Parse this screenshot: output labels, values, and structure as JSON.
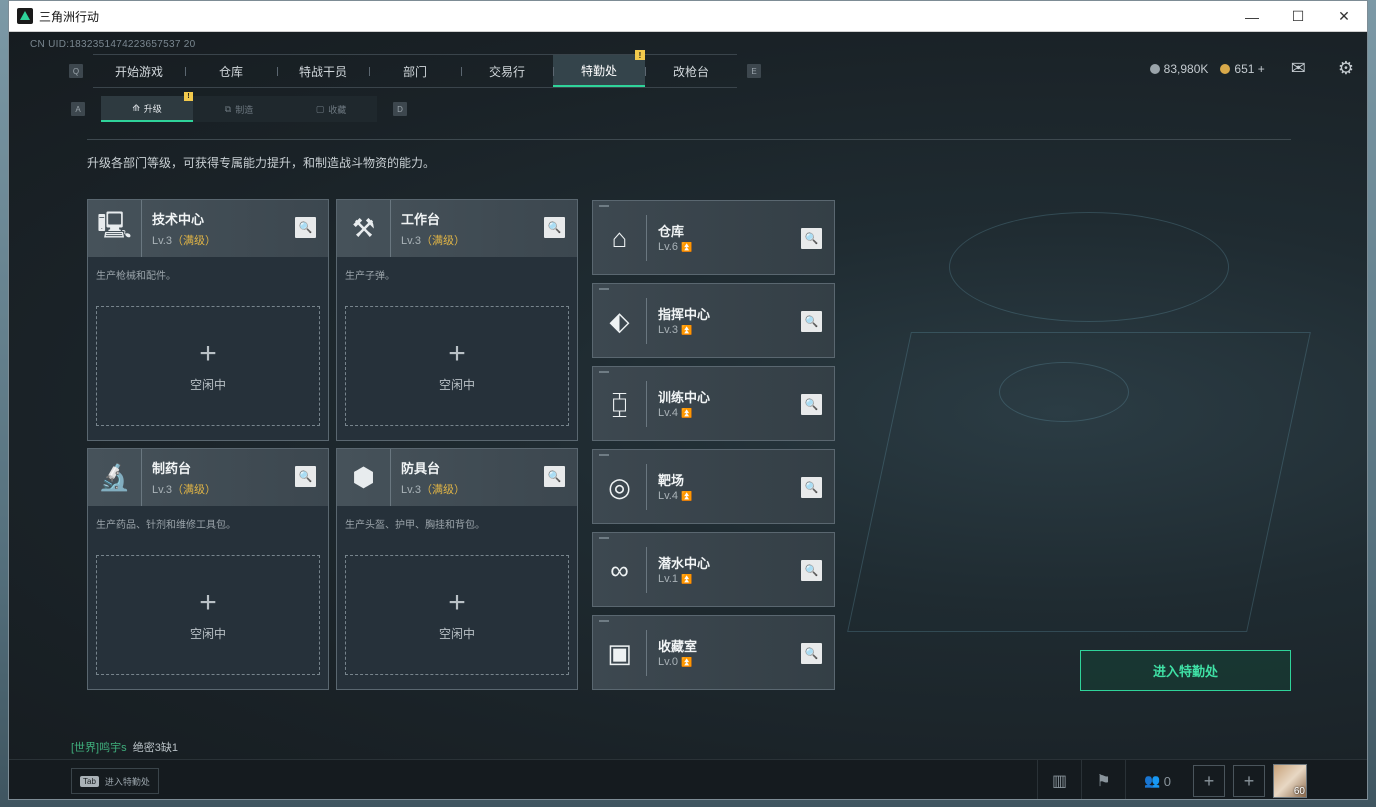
{
  "window": {
    "title": "三角洲行动"
  },
  "uid": "CN UID:1832351474223657537 20",
  "nav": {
    "key_left": "Q",
    "key_right": "E",
    "tabs": [
      {
        "label": "开始游戏"
      },
      {
        "label": "仓库"
      },
      {
        "label": "特战干员"
      },
      {
        "label": "部门"
      },
      {
        "label": "交易行"
      },
      {
        "label": "特勤处",
        "badge": "!"
      },
      {
        "label": "改枪台"
      }
    ]
  },
  "subnav": {
    "key_left": "A",
    "key_right": "D",
    "tabs": [
      {
        "label": "升级",
        "badge": "!"
      },
      {
        "label": "制造"
      },
      {
        "label": "收藏"
      }
    ]
  },
  "resources": {
    "silver": "83,980K",
    "gold": "651 +"
  },
  "description": "升级各部门等级，可获得专属能力提升，和制造战斗物资的能力。",
  "workshops": [
    {
      "name": "技术中心",
      "lv": "Lv.3",
      "max": "（满级）",
      "desc": "生产枪械和配件。",
      "status": "空闲中",
      "icon": "computer-icon",
      "glyph": "🖳"
    },
    {
      "name": "工作台",
      "lv": "Lv.3",
      "max": "（满级）",
      "desc": "生产子弹。",
      "status": "空闲中",
      "icon": "tools-icon",
      "glyph": "⚒"
    },
    {
      "name": "制药台",
      "lv": "Lv.3",
      "max": "（满级）",
      "desc": "生产药品、针剂和维修工具包。",
      "status": "空闲中",
      "icon": "microscope-icon",
      "glyph": "🔬"
    },
    {
      "name": "防具台",
      "lv": "Lv.3",
      "max": "（满级）",
      "desc": "生产头盔、护甲、胸挂和背包。",
      "status": "空闲中",
      "icon": "cubes-icon",
      "glyph": "⬢"
    }
  ],
  "facilities": [
    {
      "name": "仓库",
      "lv": "Lv.6",
      "icon": "warehouse-icon",
      "glyph": "⌂"
    },
    {
      "name": "指挥中心",
      "lv": "Lv.3",
      "icon": "chip-icon",
      "glyph": "⬖"
    },
    {
      "name": "训练中心",
      "lv": "Lv.4",
      "icon": "dumbbell-icon",
      "glyph": "⧮"
    },
    {
      "name": "靶场",
      "lv": "Lv.4",
      "icon": "target-icon",
      "glyph": "◎"
    },
    {
      "name": "潜水中心",
      "lv": "Lv.1",
      "icon": "diving-mask-icon",
      "glyph": "∞"
    },
    {
      "name": "收藏室",
      "lv": "Lv.0",
      "icon": "display-case-icon",
      "glyph": "▣"
    }
  ],
  "enter_button": "进入特勤处",
  "chat": {
    "channel": "[世界]",
    "user": "鸣宇s",
    "message": "绝密3缺1"
  },
  "bottom": {
    "tab_key": "Tab",
    "tab_hint": "进入特勤处",
    "friends": "0",
    "level": "60"
  }
}
